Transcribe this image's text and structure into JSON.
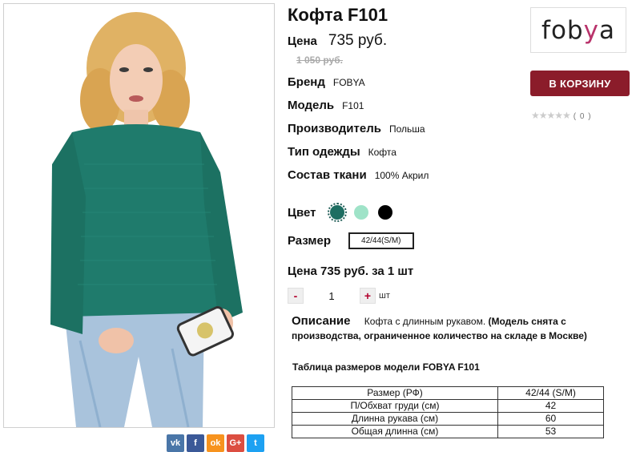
{
  "product": {
    "title": "Кофта F101",
    "price_label": "Цена",
    "price": "735 руб.",
    "old_price": "1 050 руб.",
    "brand_label": "Бренд",
    "brand": "FOBYA",
    "model_label": "Модель",
    "model": "F101",
    "maker_label": "Производитель",
    "maker": "Польша",
    "type_label": "Тип одежды",
    "type": "Кофта",
    "fabric_label": "Состав ткани",
    "fabric": "100% Акрил",
    "color_label": "Цвет",
    "colors": [
      "#1e6e62",
      "#9fe3c8",
      "#000000"
    ],
    "size_label": "Размер",
    "size_selected": "42/44(S/M)",
    "total_text": "Цена 735 руб. за 1 шт",
    "qty_minus": "-",
    "qty_value": "1",
    "qty_plus": "+",
    "qty_unit": "шт"
  },
  "description": {
    "heading": "Описание",
    "text": "Кофта с длинным рукавом.",
    "bold_text": "(Модель снята с производства, ограниченное количество на складе в Москве)"
  },
  "size_table": {
    "title": "Таблица размеров модели FOBYA F101",
    "rows": [
      [
        "Размер (РФ)",
        "42/44 (S/M)"
      ],
      [
        "П/Обхват груди (см)",
        "42"
      ],
      [
        "Длинна рукава (см)",
        "60"
      ],
      [
        "Общая длинна (см)",
        "53"
      ]
    ]
  },
  "sidebar": {
    "logo_a": "fob",
    "logo_b": "y",
    "logo_c": "a",
    "cart_button": "В КОРЗИНУ",
    "stars": "★★★★★",
    "reviews": "( 0 )"
  },
  "share": {
    "icons": [
      "vk-icon",
      "facebook-icon",
      "odnoklassniki-icon",
      "google-plus-icon",
      "twitter-icon"
    ],
    "labels": [
      "vk",
      "f",
      "ok",
      "G+",
      "t"
    ],
    "colors": [
      "#4a76a8",
      "#3b5998",
      "#f7931e",
      "#dc4e41",
      "#1da1f2"
    ]
  }
}
